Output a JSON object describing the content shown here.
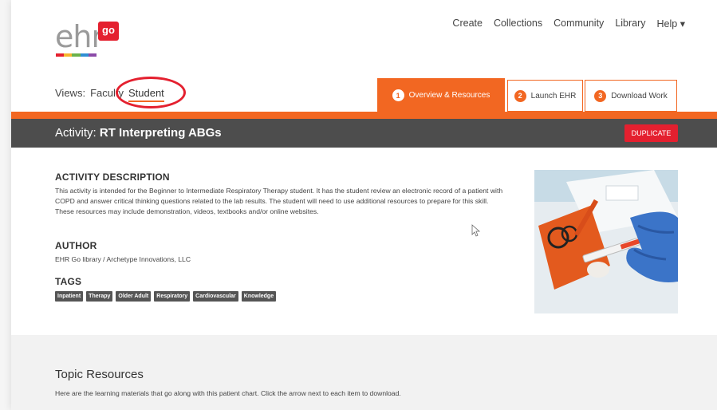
{
  "header": {
    "logo": {
      "word": "ehr",
      "badge": "go",
      "stripe_colors": [
        "#e4202f",
        "#f7b52c",
        "#6bb24a",
        "#2e8fd4",
        "#8b4aa8"
      ]
    },
    "nav": [
      "Create",
      "Collections",
      "Community",
      "Library",
      "Help ▾"
    ]
  },
  "views": {
    "label": "Views:",
    "faculty": "Faculty",
    "student": "Student"
  },
  "tabs": [
    {
      "num": "1",
      "label": "Overview & Resources",
      "active": true
    },
    {
      "num": "2",
      "label": "Launch EHR",
      "active": false
    },
    {
      "num": "3",
      "label": "Download Work",
      "active": false
    }
  ],
  "activity": {
    "prefix": "Activity:",
    "name": "RT Interpreting ABGs",
    "duplicate_label": "DUPLICATE"
  },
  "description": {
    "heading": "ACTIVITY DESCRIPTION",
    "text": "This activity is intended for the Beginner to Intermediate Respiratory Therapy student. It has the student review an electronic record of a patient with COPD and answer critical thinking questions related to the lab results. The student will need to use additional resources to prepare for this skill. These resources may include demonstration, videos, textbooks and/or online websites."
  },
  "author": {
    "heading": "AUTHOR",
    "text": "EHR Go library / Archetype Innovations, LLC"
  },
  "tags": {
    "heading": "TAGS",
    "items": [
      "Inpatient",
      "Therapy",
      "Older Adult",
      "Respiratory",
      "Cardiovascular",
      "Knowledge"
    ]
  },
  "topic": {
    "heading": "Topic Resources",
    "text": "Here are the learning materials that go along with this patient chart. Click the arrow next to each item to download."
  },
  "colors": {
    "accent": "#f26722",
    "red": "#e4202f",
    "titlebar": "#4d4d4d"
  }
}
